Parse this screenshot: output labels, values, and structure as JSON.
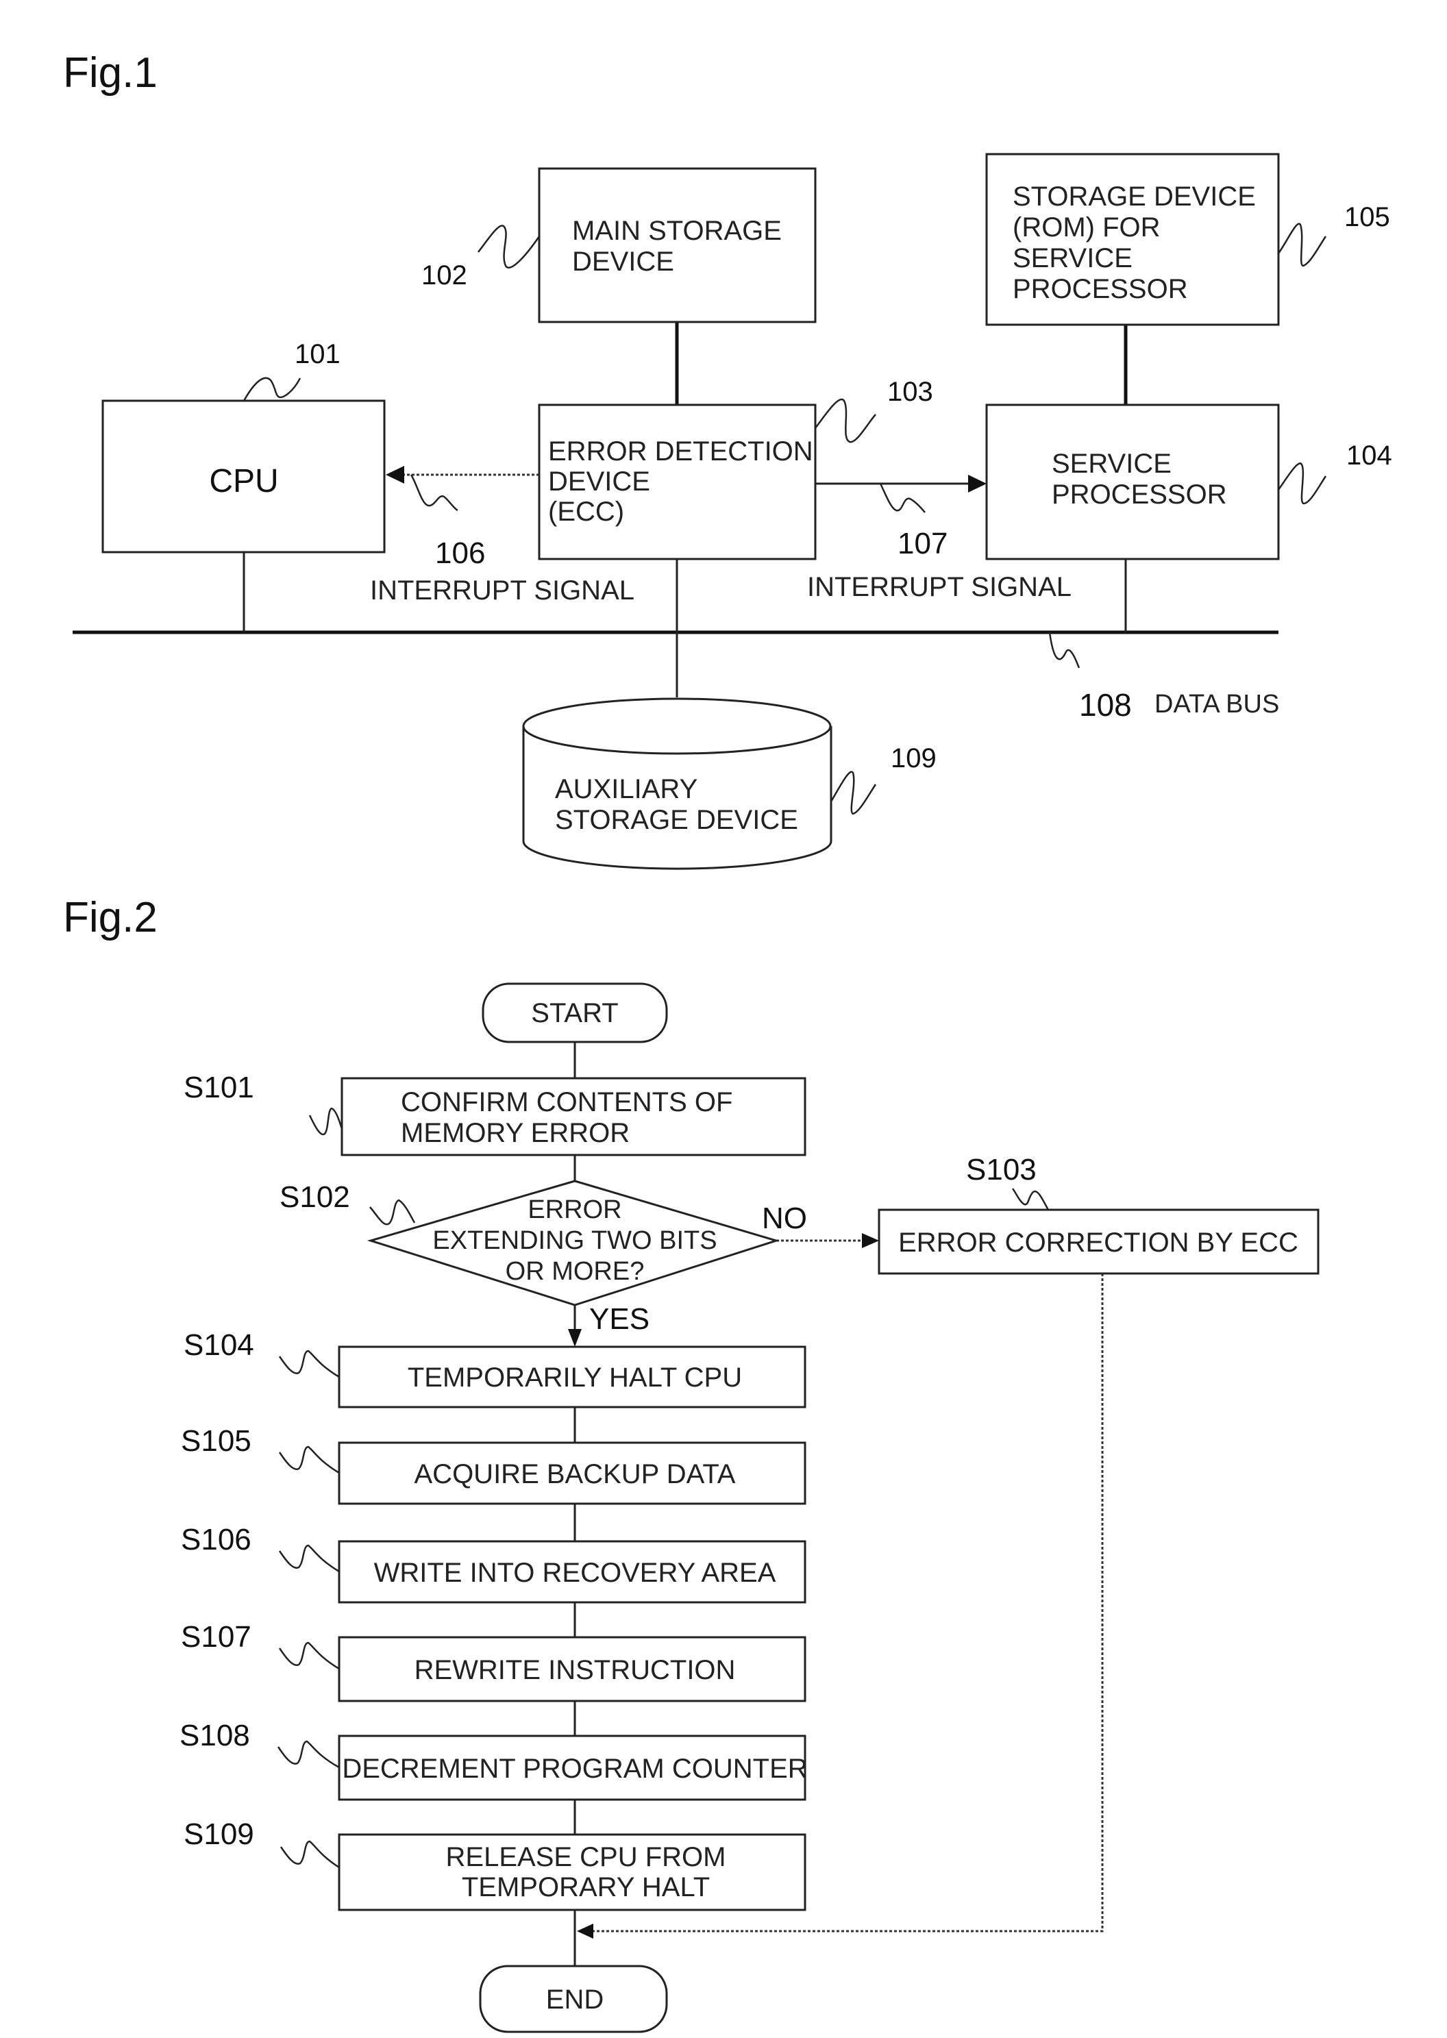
{
  "fig1": {
    "label": "Fig.1",
    "blocks": {
      "cpu": {
        "ref": "101",
        "lines": [
          "CPU"
        ]
      },
      "main_storage": {
        "ref": "102",
        "lines": [
          "MAIN STORAGE",
          "DEVICE"
        ]
      },
      "ecc": {
        "ref": "103",
        "lines": [
          "ERROR DETECTION",
          "DEVICE",
          "(ECC)"
        ]
      },
      "service_processor": {
        "ref": "104",
        "lines": [
          "SERVICE",
          "PROCESSOR"
        ]
      },
      "rom": {
        "ref": "105",
        "lines": [
          "STORAGE DEVICE",
          "(ROM) FOR",
          "SERVICE",
          "PROCESSOR"
        ]
      },
      "auxiliary_storage": {
        "ref": "109",
        "lines": [
          "AUXILIARY",
          "STORAGE DEVICE"
        ]
      }
    },
    "signals": {
      "interrupt_cpu": {
        "ref": "106",
        "label": "INTERRUPT SIGNAL"
      },
      "interrupt_sp": {
        "ref": "107",
        "label": "INTERRUPT SIGNAL"
      }
    },
    "bus": {
      "ref": "108",
      "label": "DATA BUS"
    }
  },
  "fig2": {
    "label": "Fig.2",
    "start": "START",
    "end": "END",
    "steps": [
      {
        "id": "S101",
        "lines": [
          "CONFIRM CONTENTS OF",
          "MEMORY ERROR"
        ]
      },
      {
        "id": "S104",
        "lines": [
          "TEMPORARILY HALT CPU"
        ]
      },
      {
        "id": "S105",
        "lines": [
          "ACQUIRE BACKUP DATA"
        ]
      },
      {
        "id": "S106",
        "lines": [
          "WRITE INTO RECOVERY AREA"
        ]
      },
      {
        "id": "S107",
        "lines": [
          "REWRITE INSTRUCTION"
        ]
      },
      {
        "id": "S108",
        "lines": [
          "DECREMENT PROGRAM COUNTER"
        ]
      },
      {
        "id": "S109",
        "lines": [
          "RELEASE CPU FROM",
          "TEMPORARY HALT"
        ]
      }
    ],
    "decision": {
      "id": "S102",
      "lines": [
        "ERROR",
        "EXTENDING TWO BITS",
        "OR MORE?"
      ],
      "yes_label": "YES",
      "no_label": "NO"
    },
    "correction": {
      "id": "S103",
      "lines": [
        "ERROR CORRECTION BY ECC"
      ]
    }
  }
}
